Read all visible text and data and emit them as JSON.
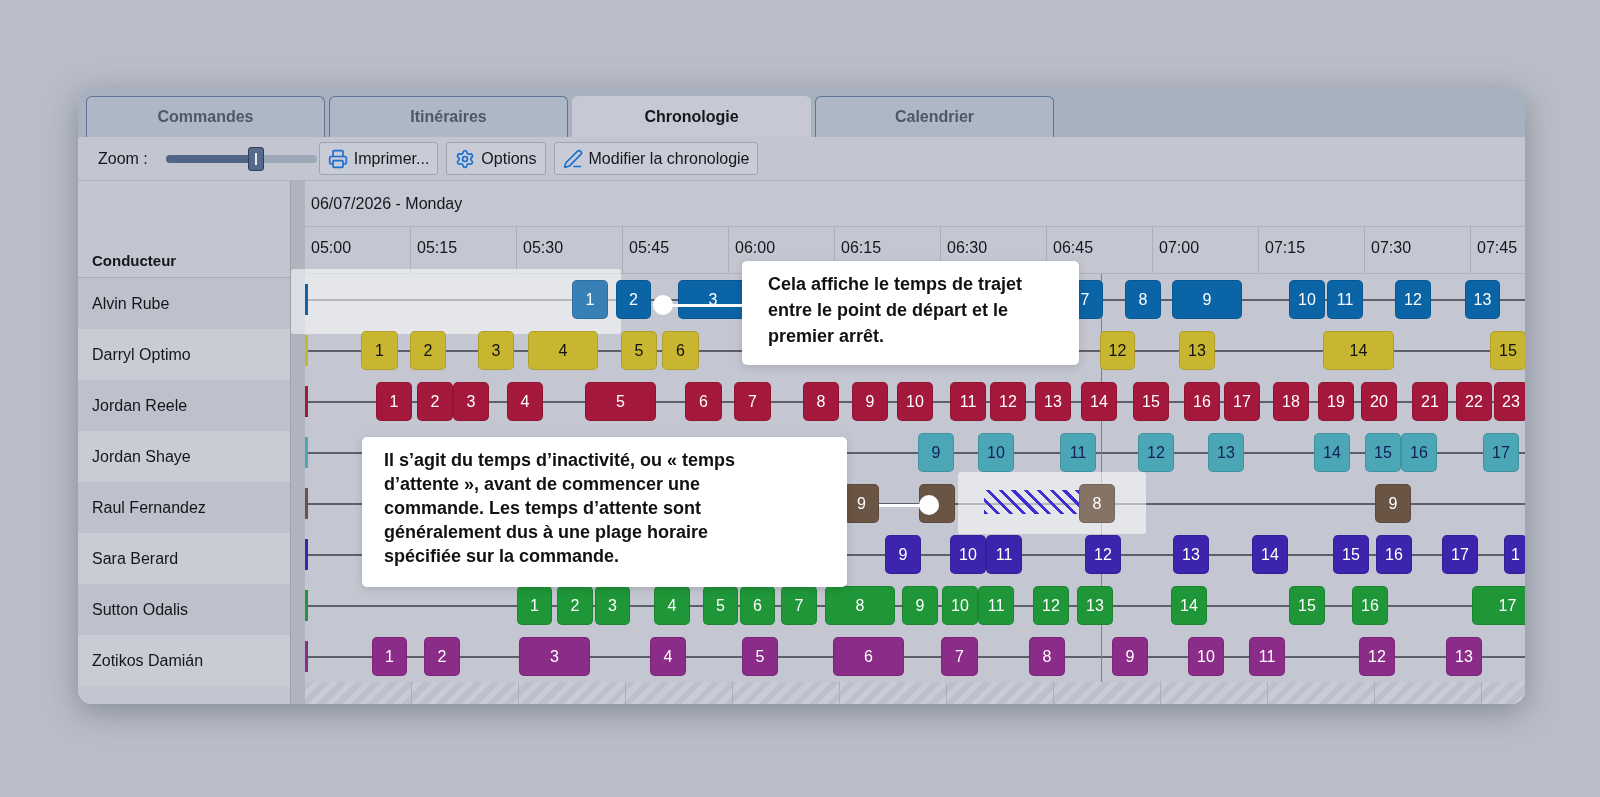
{
  "tabs": [
    {
      "label": "Commandes",
      "selected": false
    },
    {
      "label": "Itinéraires",
      "selected": false
    },
    {
      "label": "Chronologie",
      "selected": true
    },
    {
      "label": "Calendrier",
      "selected": false
    }
  ],
  "toolbar": {
    "zoom_label": "Zoom :",
    "zoom": {
      "level": 0.6
    },
    "buttons": [
      "Imprimer...",
      "Options",
      "Modifier la chronologie"
    ]
  },
  "timeline": {
    "driver_header": "Conducteur",
    "date": "06/07/2026 - Monday",
    "times": [
      "05:00",
      "05:15",
      "05:30",
      "05:45",
      "06:00",
      "06:15",
      "06:30",
      "06:45",
      "07:00",
      "07:15",
      "07:30",
      "07:45"
    ],
    "drivers": [
      {
        "name": "Alvin Rube",
        "color": "#0b64a6",
        "orders": [
          {
            "label": "1",
            "highlighted": true
          },
          {
            "label": "2",
            "highlighted": false
          },
          {
            "label": "3",
            "highlighted": false
          },
          {
            "label": "7",
            "highlighted": false
          },
          {
            "label": "8",
            "highlighted": false
          },
          {
            "label": "9",
            "highlighted": false
          },
          {
            "label": "10",
            "highlighted": false
          },
          {
            "label": "11",
            "highlighted": false
          },
          {
            "label": "12",
            "highlighted": false
          },
          {
            "label": "13",
            "highlighted": false
          }
        ]
      },
      {
        "name": "Darryl Optimo",
        "color": "#c8b630",
        "orders": [
          {
            "label": "1",
            "highlighted": false
          },
          {
            "label": "2",
            "highlighted": false
          },
          {
            "label": "3",
            "highlighted": false
          },
          {
            "label": "4",
            "highlighted": false
          },
          {
            "label": "5",
            "highlighted": false
          },
          {
            "label": "6",
            "highlighted": false
          },
          {
            "label": "12",
            "highlighted": false
          },
          {
            "label": "13",
            "highlighted": false
          },
          {
            "label": "14",
            "highlighted": false
          },
          {
            "label": "15",
            "highlighted": false
          }
        ]
      },
      {
        "name": "Jordan Reele",
        "color": "#a3183b",
        "orders": [
          {
            "label": "1",
            "highlighted": false
          },
          {
            "label": "2",
            "highlighted": false
          },
          {
            "label": "3",
            "highlighted": false
          },
          {
            "label": "4",
            "highlighted": false
          },
          {
            "label": "5",
            "highlighted": false
          },
          {
            "label": "6",
            "highlighted": false
          },
          {
            "label": "7",
            "highlighted": false
          },
          {
            "label": "8",
            "highlighted": false
          },
          {
            "label": "9",
            "highlighted": false
          },
          {
            "label": "10",
            "highlighted": false
          },
          {
            "label": "11",
            "highlighted": false
          },
          {
            "label": "12",
            "highlighted": false
          },
          {
            "label": "13",
            "highlighted": false
          },
          {
            "label": "14",
            "highlighted": false
          },
          {
            "label": "15",
            "highlighted": false
          },
          {
            "label": "16",
            "highlighted": false
          },
          {
            "label": "17",
            "highlighted": false
          },
          {
            "label": "18",
            "highlighted": false
          },
          {
            "label": "19",
            "highlighted": false
          },
          {
            "label": "20",
            "highlighted": false
          },
          {
            "label": "21",
            "highlighted": false
          },
          {
            "label": "22",
            "highlighted": false
          },
          {
            "label": "23",
            "highlighted": false
          }
        ]
      },
      {
        "name": "Jordan Shaye",
        "color": "#4ba6b6",
        "orders": [
          {
            "label": "9",
            "highlighted": false
          },
          {
            "label": "10",
            "highlighted": false
          },
          {
            "label": "11",
            "highlighted": false
          },
          {
            "label": "12",
            "highlighted": false
          },
          {
            "label": "13",
            "highlighted": false
          },
          {
            "label": "14",
            "highlighted": false
          },
          {
            "label": "15",
            "highlighted": false
          },
          {
            "label": "16",
            "highlighted": false
          },
          {
            "label": "17",
            "highlighted": false
          }
        ]
      },
      {
        "name": "Raul Fernandez",
        "color": "#6a5444",
        "orders": [
          {
            "label": "9",
            "highlighted": false
          },
          {
            "highlighted": false
          },
          {
            "label": "8",
            "highlighted": true
          },
          {
            "label": "9",
            "highlighted": false
          }
        ]
      },
      {
        "name": "Sara Berard",
        "color": "#3d24ad",
        "orders": [
          {
            "label": "9",
            "highlighted": false
          },
          {
            "label": "10",
            "highlighted": false
          },
          {
            "label": "11",
            "highlighted": false
          },
          {
            "label": "12",
            "highlighted": false
          },
          {
            "label": "13",
            "highlighted": false
          },
          {
            "label": "14",
            "highlighted": false
          },
          {
            "label": "15",
            "highlighted": false
          },
          {
            "label": "16",
            "highlighted": false
          },
          {
            "label": "17",
            "highlighted": false
          },
          {
            "label": "1",
            "highlighted": false
          }
        ]
      },
      {
        "name": "Sutton Odalis",
        "color": "#1f9738",
        "orders": [
          {
            "label": "1",
            "highlighted": false
          },
          {
            "label": "2",
            "highlighted": false
          },
          {
            "label": "3",
            "highlighted": false
          },
          {
            "label": "4",
            "highlighted": false
          },
          {
            "label": "5",
            "highlighted": false
          },
          {
            "label": "6",
            "highlighted": false
          },
          {
            "label": "7",
            "highlighted": false
          },
          {
            "label": "8",
            "highlighted": false
          },
          {
            "label": "9",
            "highlighted": false
          },
          {
            "label": "10",
            "highlighted": false
          },
          {
            "label": "11",
            "highlighted": false
          },
          {
            "label": "12",
            "highlighted": false
          },
          {
            "label": "13",
            "highlighted": false
          },
          {
            "label": "14",
            "highlighted": false
          },
          {
            "label": "15",
            "highlighted": false
          },
          {
            "label": "16",
            "highlighted": false
          },
          {
            "label": "17",
            "highlighted": false
          }
        ]
      },
      {
        "name": "Zotikos Damián",
        "color": "#8a2c88",
        "orders": [
          {
            "label": "1",
            "highlighted": false
          },
          {
            "label": "2",
            "highlighted": false
          },
          {
            "label": "3",
            "highlighted": false
          },
          {
            "label": "4",
            "highlighted": false
          },
          {
            "label": "5",
            "highlighted": false
          },
          {
            "label": "6",
            "highlighted": false
          },
          {
            "label": "7",
            "highlighted": false
          },
          {
            "label": "8",
            "highlighted": false
          },
          {
            "label": "9",
            "highlighted": false
          },
          {
            "label": "10",
            "highlighted": false
          },
          {
            "label": "11",
            "highlighted": false
          },
          {
            "label": "12",
            "highlighted": false
          },
          {
            "label": "13",
            "highlighted": false
          }
        ]
      }
    ]
  },
  "callouts": [
    {
      "text": "Cela affiche le temps de trajet entre le point de départ et le premier arrêt."
    },
    {
      "text": "Il s’agit du temps d’inactivité, ou « temps d’attente », avant de commencer une commande. Les temps d’attente sont généralement dus à une plage horaire spécifiée sur la commande."
    }
  ]
}
